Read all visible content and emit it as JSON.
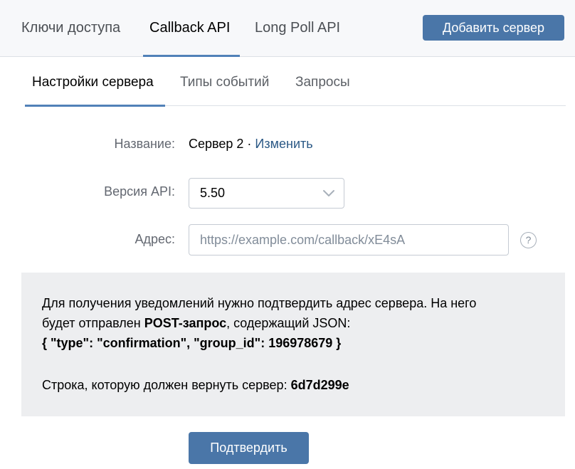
{
  "top_tabs": [
    {
      "label": "Ключи доступа",
      "active": false
    },
    {
      "label": "Callback API",
      "active": true
    },
    {
      "label": "Long Poll API",
      "active": false
    }
  ],
  "add_server_label": "Добавить сервер",
  "sub_tabs": [
    {
      "label": "Настройки сервера",
      "active": true
    },
    {
      "label": "Типы событий",
      "active": false
    },
    {
      "label": "Запросы",
      "active": false
    }
  ],
  "form": {
    "name_label": "Название:",
    "name_value": "Сервер 2",
    "name_separator": " · ",
    "name_change_link": "Изменить",
    "api_version_label": "Версия API:",
    "api_version_value": "5.50",
    "address_label": "Адрес:",
    "address_placeholder": "https://example.com/callback/xE4sA",
    "help_symbol": "?"
  },
  "info": {
    "line1": "Для получения уведомлений нужно подтвердить адрес сервера. На него",
    "line2_prefix": "будет отправлен ",
    "line2_bold": "POST-запрос",
    "line2_suffix": ", содержащий JSON:",
    "json": "{ \"type\": \"confirmation\", \"group_id\": 196978679 }",
    "response_prefix": "Строка, которую должен вернуть сервер: ",
    "response_code": "6d7d299e"
  },
  "confirm_label": "Подтвердить",
  "colors": {
    "accent": "#4a76a8",
    "link": "#2a5885",
    "tab_underline": "#5181b8",
    "info_background": "#edeef0"
  },
  "icons": {
    "chevron": "chevron-down-icon",
    "help": "help-icon"
  }
}
